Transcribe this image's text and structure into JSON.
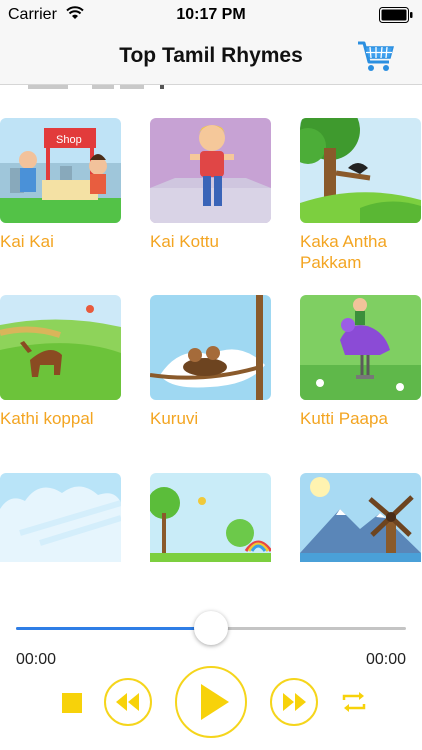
{
  "status_bar": {
    "carrier": "Carrier",
    "time": "10:17 PM"
  },
  "nav": {
    "title": "Top Tamil Rhymes",
    "cart_icon": "cart-icon"
  },
  "rhymes": [
    {
      "title": "Kai Kai",
      "thumb_label": "Shop"
    },
    {
      "title": "Kai Kottu"
    },
    {
      "title": "Kaka Antha Pakkam"
    },
    {
      "title": "Kathi koppal"
    },
    {
      "title": "Kuruvi"
    },
    {
      "title": "Kutti Paapa"
    },
    {
      "title": ""
    },
    {
      "title": ""
    },
    {
      "title": ""
    }
  ],
  "player": {
    "elapsed": "00:00",
    "total": "00:00",
    "progress": 0.5,
    "controls": [
      "stop-icon",
      "rewind-icon",
      "play-icon",
      "fast-forward-icon",
      "repeat-icon"
    ]
  },
  "colors": {
    "accent_yellow": "#f5d51c",
    "label_orange": "#f3a522",
    "progress_blue": "#2f7ee6"
  }
}
